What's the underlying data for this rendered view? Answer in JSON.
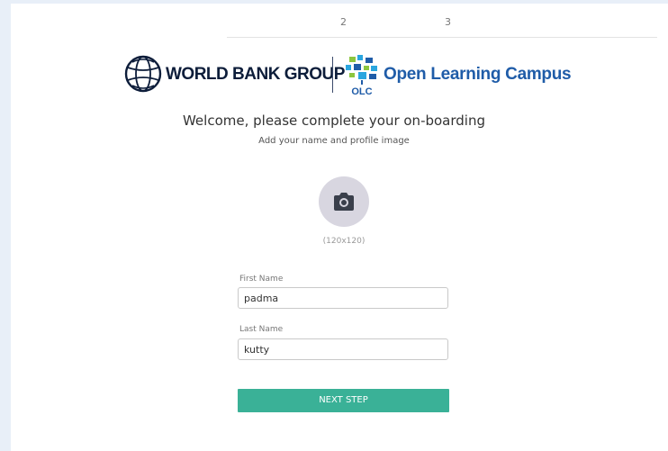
{
  "stepper": {
    "steps": [
      "2",
      "3"
    ]
  },
  "header": {
    "wbg_label": "WORLD BANK GROUP",
    "olc_label": "Open Learning Campus",
    "olc_mark_text": "OLC"
  },
  "onboarding": {
    "title": "Welcome, please complete your on-boarding",
    "subtitle": "Add your name and profile image",
    "avatar_icon": "camera-icon",
    "avatar_size_hint": "(120x120)"
  },
  "form": {
    "first_name_label": "First Name",
    "first_name_value": "padma",
    "last_name_label": "Last Name",
    "last_name_value": "kutty",
    "next_label": "NEXT STEP"
  },
  "colors": {
    "accent": "#3ab197",
    "wbg_navy": "#0d1d3a",
    "olc_blue": "#1f5ca8",
    "avatar_bg": "#d8d6e0",
    "page_bg": "#e8eff8"
  }
}
